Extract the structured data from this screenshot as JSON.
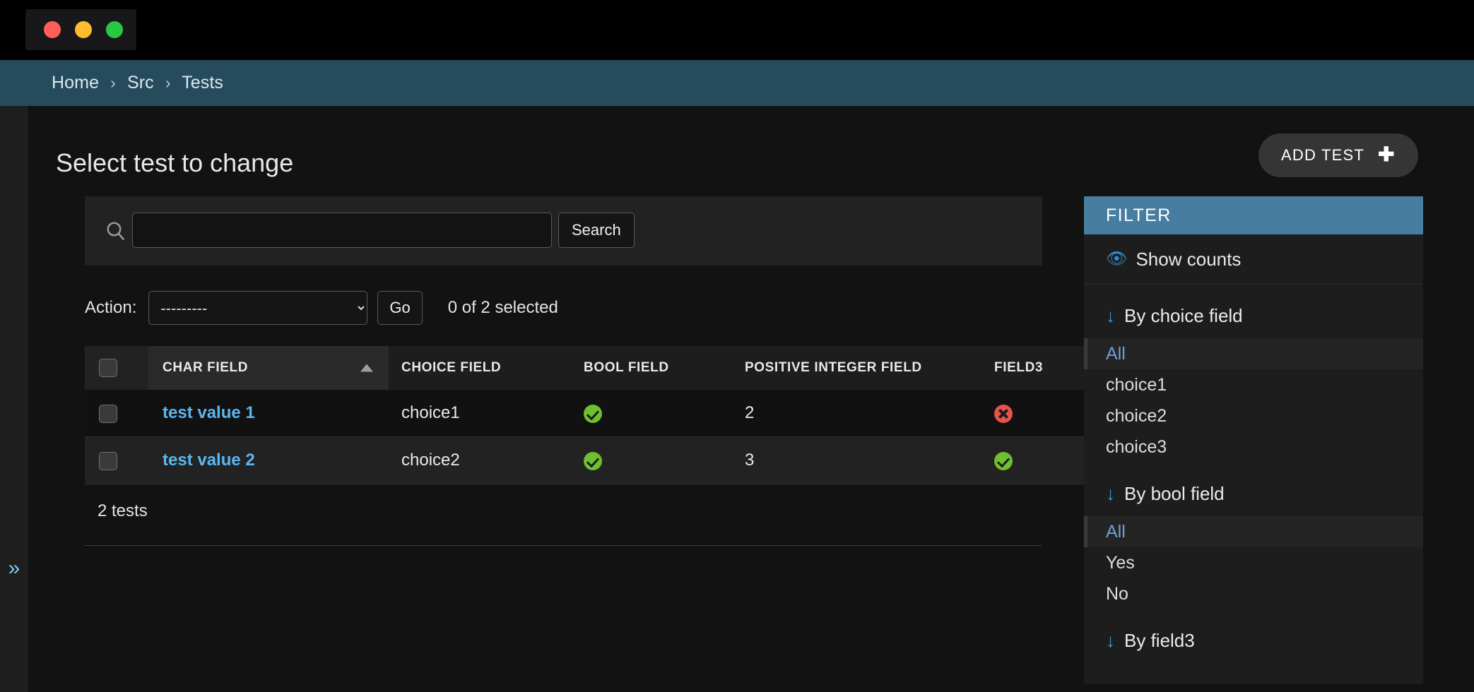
{
  "window": {
    "traffic_lights": [
      "close-red",
      "minimize-amber",
      "maximize-green"
    ]
  },
  "breadcrumb": {
    "items": [
      "Home",
      "Src",
      "Tests"
    ],
    "separator": "›"
  },
  "left_rail": {
    "toggle_icon": "»"
  },
  "header": {
    "title": "Select test to change",
    "add_button_label": "ADD TEST",
    "add_button_icon": "✚"
  },
  "search": {
    "icon": "search-icon",
    "value": "",
    "placeholder": "",
    "button_label": "Search"
  },
  "actions": {
    "label": "Action:",
    "selected_option": "---------",
    "options": [
      "---------"
    ],
    "go_label": "Go",
    "selection_counter": "0 of 2 selected"
  },
  "table": {
    "columns": [
      {
        "key": "select",
        "label": ""
      },
      {
        "key": "char",
        "label": "CHAR FIELD",
        "sorted": "asc"
      },
      {
        "key": "choice",
        "label": "CHOICE FIELD"
      },
      {
        "key": "bool",
        "label": "BOOL FIELD"
      },
      {
        "key": "posint",
        "label": "POSITIVE INTEGER FIELD"
      },
      {
        "key": "field3",
        "label": "FIELD3"
      }
    ],
    "rows": [
      {
        "char": "test value 1",
        "choice": "choice1",
        "bool": "yes",
        "posint": "2",
        "field3": "no"
      },
      {
        "char": "test value 2",
        "choice": "choice2",
        "bool": "yes",
        "posint": "3",
        "field3": "yes"
      }
    ],
    "result_count": "2 tests"
  },
  "filter": {
    "header": "FILTER",
    "show_counts": {
      "label": "Show counts",
      "icon": "👁"
    },
    "groups": [
      {
        "title": "By choice field",
        "icon": "↓",
        "options": [
          {
            "label": "All",
            "selected": true
          },
          {
            "label": "choice1",
            "selected": false
          },
          {
            "label": "choice2",
            "selected": false
          },
          {
            "label": "choice3",
            "selected": false
          }
        ]
      },
      {
        "title": "By bool field",
        "icon": "↓",
        "options": [
          {
            "label": "All",
            "selected": true
          },
          {
            "label": "Yes",
            "selected": false
          },
          {
            "label": "No",
            "selected": false
          }
        ]
      },
      {
        "title": "By field3",
        "icon": "↓",
        "options": []
      }
    ]
  },
  "colors": {
    "breadcrumb_bar": "#264b5d",
    "filter_header": "#467da0",
    "link": "#5ab7f0",
    "status_yes": "#6fbf2f",
    "status_no": "#e8524c",
    "accent_blue": "#2e9fe0"
  }
}
